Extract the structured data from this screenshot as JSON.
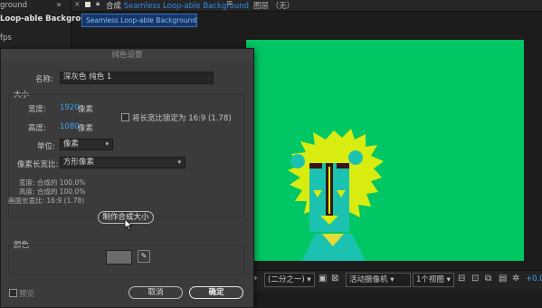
{
  "project_panel": {
    "items": [
      "ground",
      "Loop-able Background ▾",
      "fps"
    ]
  },
  "top_tab": {
    "prefix": "合成",
    "title": "Seamless Loop-able Background",
    "layer_label": "图层 （无）",
    "subtab": "Seamless Loop-able Background"
  },
  "viewer_toolbar": {
    "zoom_ratio": "(二分之一)",
    "camera": "活动摄像机",
    "views": "1个视图",
    "offset": "+0.0"
  },
  "dialog": {
    "title": "纯色设置",
    "name_label": "名称:",
    "name_value": "深灰色 纯色 1",
    "size_label": "大小",
    "width_label": "宽度:",
    "width_value": "1920",
    "width_unit": "像素",
    "height_label": "高度:",
    "height_value": "1080",
    "height_unit": "像素",
    "lock_label": "将长宽比锁定为 16:9 (1.78)",
    "units_label": "单位:",
    "units_value": "像素",
    "pixel_aspect_label": "像素长宽比:",
    "pixel_aspect_value": "方形像素",
    "info_width": "宽度: 合成的 100.0%",
    "info_height": "高度: 合成的 100.0%",
    "info_frame": "画面长宽比: 16:9 (1.78)",
    "make_comp_size": "制作合成大小",
    "color_label": "颜色",
    "preview_label": "预览",
    "cancel": "取消",
    "ok": "确定"
  },
  "colors": {
    "canvas_bg": "#00c763",
    "mane": "#d8ec10",
    "face": "#1cc2b0",
    "swatch": "#6b6b6b",
    "accent_blue": "#39a6f0"
  }
}
